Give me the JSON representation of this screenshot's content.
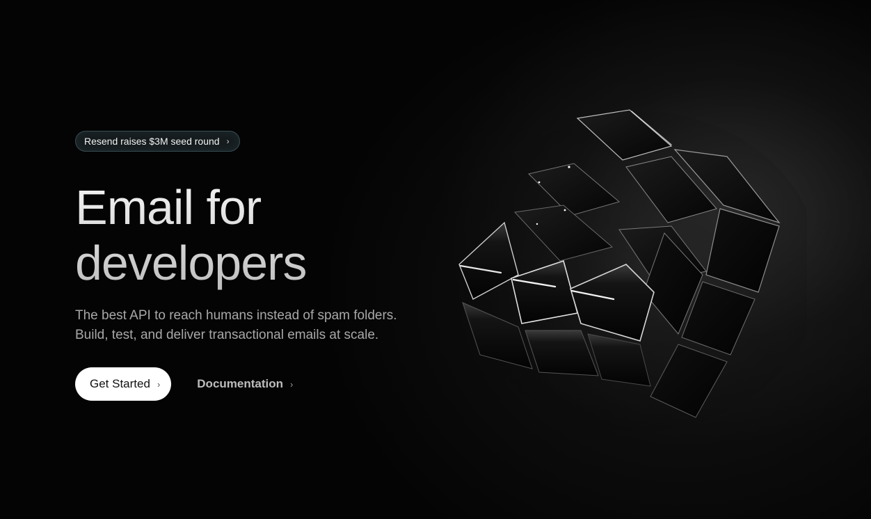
{
  "announcement": {
    "label": "Resend raises $3M seed round",
    "chevron_icon": "chevron-right-icon"
  },
  "hero": {
    "headline_line1": "Email for",
    "headline_line2": "developers",
    "subtitle_line1": "The best API to reach humans instead of spam folders.",
    "subtitle_line2": "Build, test, and deliver transactional emails at scale."
  },
  "actions": {
    "primary_label": "Get Started",
    "secondary_label": "Documentation",
    "chevron_icon": "chevron-right-icon"
  },
  "illustration": {
    "name": "rubiks-cube-illustration"
  },
  "colors": {
    "background": "#040404",
    "text_primary": "#eaeaea",
    "text_muted": "#a8a8a8",
    "button_bg": "#ffffff",
    "announce_border": "#78aab4"
  }
}
